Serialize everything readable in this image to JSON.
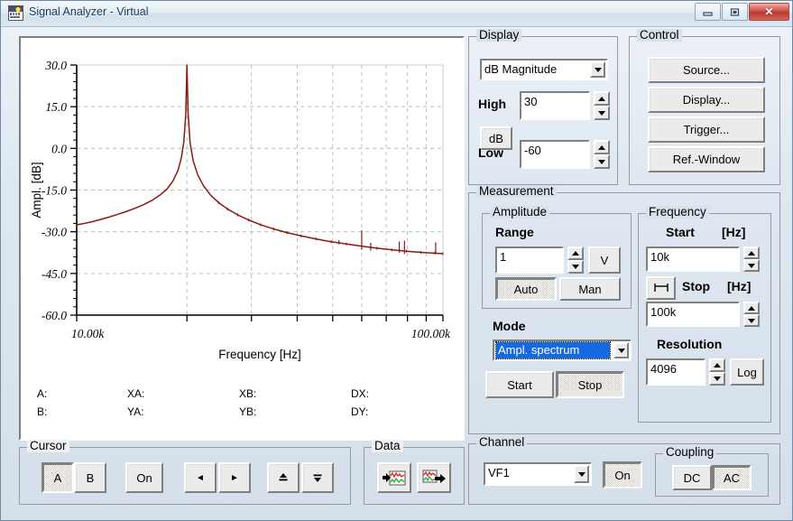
{
  "window": {
    "title": "Signal Analyzer - Virtual",
    "minimize_label": "Minimize",
    "restore_label": "Restore",
    "close_label": "✕"
  },
  "chart_data": {
    "type": "line",
    "title": "",
    "xlabel": "Frequency [Hz]",
    "ylabel": "Ampl. [dB]",
    "xscale": "log",
    "xlim": [
      10000,
      100000
    ],
    "ylim": [
      -60,
      30
    ],
    "x_tick_labels": [
      "10.00k",
      "100.00k"
    ],
    "x_minor_ticks": [
      20000,
      30000,
      40000,
      50000,
      60000,
      70000,
      80000,
      90000
    ],
    "y_tick_labels": [
      "30.0",
      "15.0",
      "0.0",
      "-15.0",
      "-30.0",
      "-45.0",
      "-60.0"
    ],
    "y_ticks": [
      30,
      15,
      0,
      -15,
      -30,
      -45,
      -60
    ],
    "grid": true,
    "line_color": "#8b1a10",
    "series": [
      {
        "name": "Ampl. spectrum",
        "x": [
          10000,
          10500,
          11000,
          11600,
          12200,
          12900,
          13600,
          14400,
          15200,
          16000,
          16800,
          17600,
          18300,
          18900,
          19300,
          19600,
          19850,
          20000,
          20150,
          20400,
          20800,
          21400,
          22200,
          23200,
          24400,
          25800,
          27500,
          29500,
          31800,
          34500,
          37500,
          41000,
          45000,
          49500,
          54500,
          60000,
          66000,
          72500,
          79500,
          87000,
          95000,
          100000
        ],
        "y": [
          -27.5,
          -27.0,
          -26.4,
          -25.6,
          -24.8,
          -23.8,
          -22.8,
          -21.6,
          -20.3,
          -18.8,
          -17.0,
          -14.8,
          -11.8,
          -8.0,
          -3.5,
          2.0,
          12.0,
          30.0,
          12.5,
          2.0,
          -4.5,
          -9.5,
          -13.5,
          -16.8,
          -19.5,
          -21.8,
          -23.9,
          -25.8,
          -27.5,
          -29.0,
          -30.3,
          -31.5,
          -32.6,
          -33.6,
          -34.4,
          -35.2,
          -35.9,
          -36.5,
          -37.0,
          -37.4,
          -37.7,
          -37.9
        ]
      }
    ],
    "spikes": [
      {
        "x": 60000,
        "y_top": -29.5,
        "y_bot": -36.5
      },
      {
        "x": 52000,
        "y_top": -33.0,
        "y_bot": -34.5
      },
      {
        "x": 63500,
        "y_top": -34.0,
        "y_bot": -36.8
      },
      {
        "x": 76000,
        "y_top": -33.5,
        "y_bot": -37.5
      },
      {
        "x": 78500,
        "y_top": -33.2,
        "y_bot": -38.0
      },
      {
        "x": 95500,
        "y_top": -33.8,
        "y_bot": -37.5
      }
    ]
  },
  "cursor_readout": {
    "row1": [
      {
        "label": "A:",
        "value": ""
      },
      {
        "label": "XA:",
        "value": ""
      },
      {
        "label": "XB:",
        "value": ""
      },
      {
        "label": "DX:",
        "value": ""
      }
    ],
    "row2": [
      {
        "label": "B:",
        "value": ""
      },
      {
        "label": "YA:",
        "value": ""
      },
      {
        "label": "YB:",
        "value": ""
      },
      {
        "label": "DY:",
        "value": ""
      }
    ]
  },
  "display": {
    "caption": "Display",
    "mode_value": "dB Magnitude",
    "high_label": "High",
    "high_value": "30",
    "low_label": "Low",
    "low_value": "-60",
    "unit_button": "dB"
  },
  "control": {
    "caption": "Control",
    "buttons": [
      {
        "label": "Source..."
      },
      {
        "label": "Display..."
      },
      {
        "label": "Trigger..."
      },
      {
        "label": "Ref.-Window"
      }
    ]
  },
  "measurement": {
    "caption": "Measurement",
    "amplitude": {
      "caption": "Amplitude",
      "range_label": "Range",
      "range_value": "1",
      "unit_button": "V",
      "auto_label": "Auto",
      "man_label": "Man",
      "active": "Auto"
    },
    "mode": {
      "label": "Mode",
      "value": "Ampl. spectrum",
      "start_label": "Start",
      "stop_label": "Stop",
      "active": "Stop"
    },
    "frequency": {
      "caption": "Frequency",
      "start_label": "Start",
      "start_unit": "[Hz]",
      "start_value": "10k",
      "stop_label": "Stop",
      "stop_unit": "[Hz]",
      "stop_value": "100k",
      "span_icon": "span-icon",
      "resolution_label": "Resolution",
      "resolution_value": "4096",
      "log_label": "Log"
    }
  },
  "cursor": {
    "caption": "Cursor",
    "a_label": "A",
    "b_label": "B",
    "on_label": "On",
    "active": "A",
    "left_icon": "◄",
    "right_icon": "►",
    "peak_up_icon": "peak-up-icon",
    "peak_down_icon": "peak-down-icon"
  },
  "data": {
    "caption": "Data",
    "load_icon": "data-load-icon",
    "save_icon": "data-save-icon"
  },
  "channel": {
    "caption": "Channel",
    "value": "VF1",
    "on_label": "On",
    "on_active": true
  },
  "coupling": {
    "caption": "Coupling",
    "dc_label": "DC",
    "ac_label": "AC",
    "active": "AC"
  }
}
